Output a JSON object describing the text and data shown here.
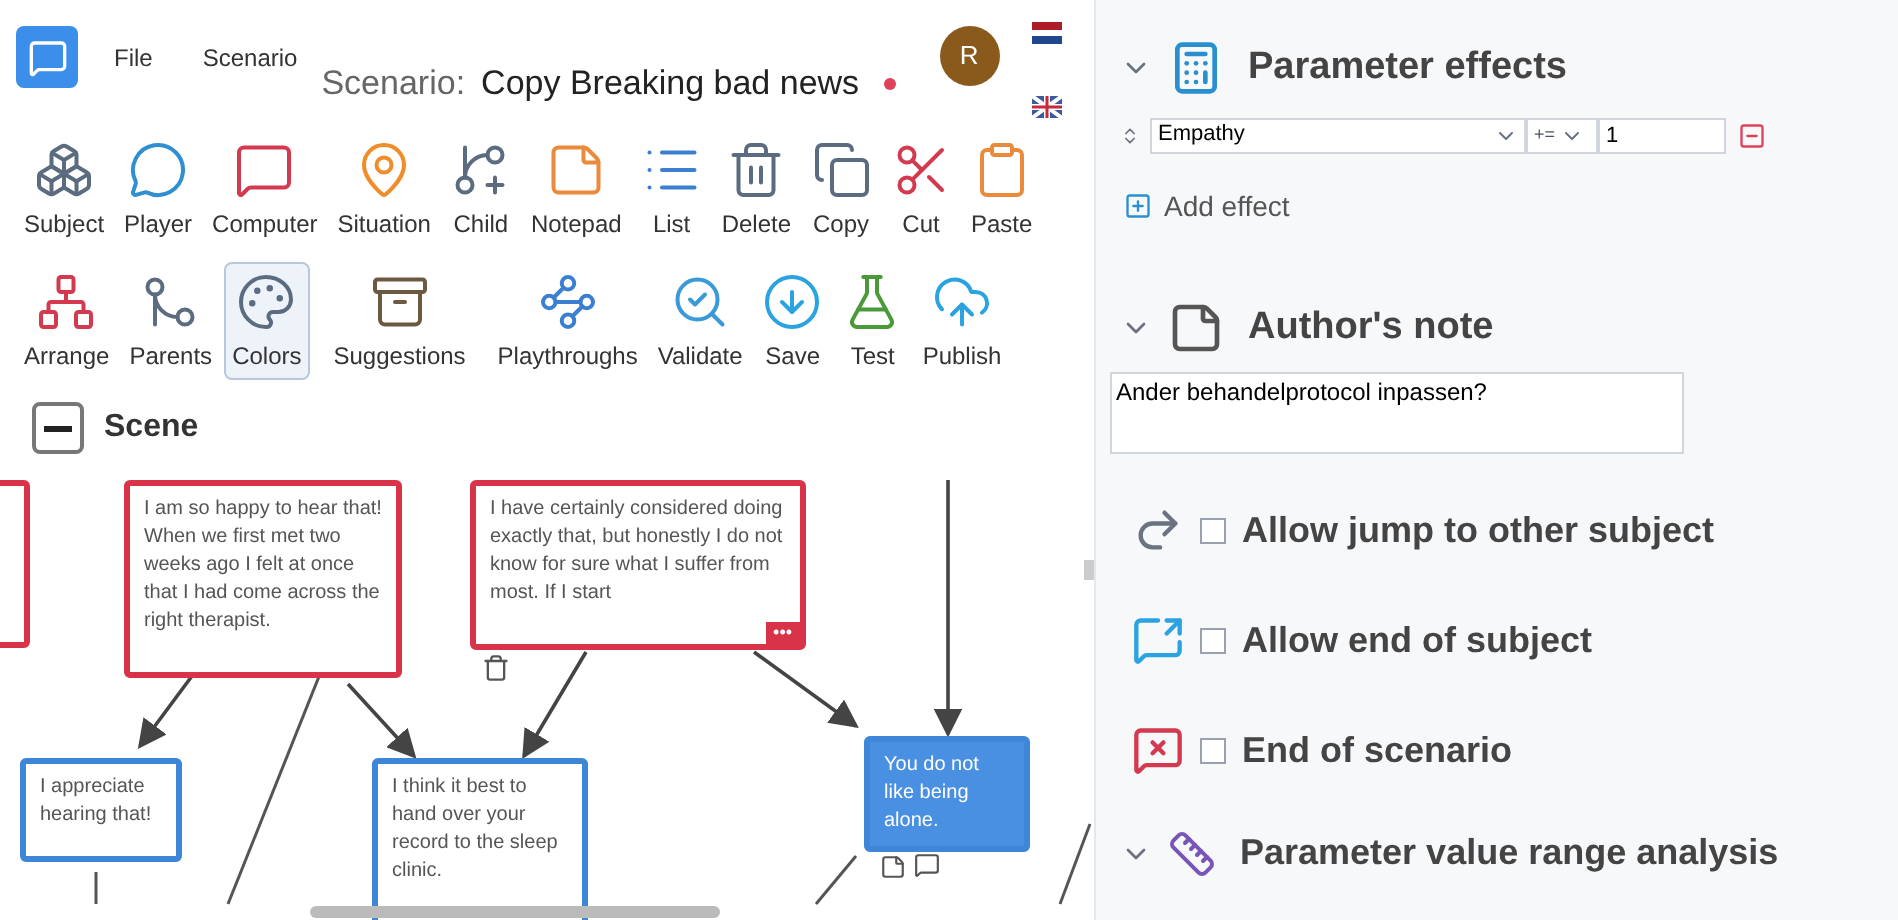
{
  "header": {
    "menu": [
      {
        "label": "File"
      },
      {
        "label": "Scenario"
      }
    ],
    "scenario_label": "Scenario:",
    "scenario_title": "Copy Breaking bad news",
    "unsaved": true,
    "avatar": "R"
  },
  "toolbar_rows": [
    [
      {
        "label": "Subject",
        "selected": false
      },
      {
        "label": "Player",
        "selected": false
      },
      {
        "label": "Computer",
        "selected": false
      },
      {
        "label": "Situation",
        "selected": false
      },
      {
        "label": "Child",
        "selected": false
      },
      {
        "label": "Notepad",
        "selected": false
      },
      {
        "label": "List",
        "selected": false
      },
      {
        "label": "Delete",
        "selected": false
      },
      {
        "label": "Copy",
        "selected": false
      },
      {
        "label": "Cut",
        "selected": false
      },
      {
        "label": "Paste",
        "selected": false
      }
    ],
    [
      {
        "label": "Arrange",
        "selected": false
      },
      {
        "label": "Parents",
        "selected": false
      },
      {
        "label": "Colors",
        "selected": true
      },
      {
        "label": "Suggestions",
        "selected": false
      },
      {
        "label": "Playthroughs",
        "selected": false
      },
      {
        "label": "Validate",
        "selected": false
      },
      {
        "label": "Save",
        "selected": false
      },
      {
        "label": "Test",
        "selected": false
      },
      {
        "label": "Publish",
        "selected": false
      }
    ]
  ],
  "scene": {
    "title": "Scene",
    "expanded": true,
    "nodes": [
      {
        "kind": "computer",
        "selected": false
      },
      {
        "kind": "computer",
        "selected": false,
        "text": "I am so happy to hear that! When we first met two weeks ago I felt at once that I had come across the right therapist."
      },
      {
        "kind": "computer",
        "selected": false,
        "text": "I have certainly considered doing exactly that, but honestly I do not know for sure what I suffer from most. If I start",
        "more": "•••"
      },
      {
        "kind": "player",
        "selected": false,
        "text": "I appreciate hearing that!"
      },
      {
        "kind": "player",
        "selected": false,
        "text": "I think it best to hand over your record to the sleep clinic."
      },
      {
        "kind": "player",
        "selected": true,
        "text": "You do not like being alone."
      }
    ]
  },
  "properties": {
    "parameter_effects": {
      "title": "Parameter effects",
      "expanded": true,
      "effects": [
        {
          "parameter": "Empathy",
          "operator": "+=",
          "value": "1"
        }
      ],
      "add_label": "Add effect"
    },
    "authors_note": {
      "title": "Author's note",
      "expanded": true,
      "text": "Ander behandelprotocol inpassen?"
    },
    "options": [
      {
        "label": "Allow jump to other subject",
        "checked": false
      },
      {
        "label": "Allow end of subject",
        "checked": false
      },
      {
        "label": "End of scenario",
        "checked": false
      }
    ],
    "range_analysis": {
      "title": "Parameter value range analysis",
      "expanded": true
    }
  }
}
